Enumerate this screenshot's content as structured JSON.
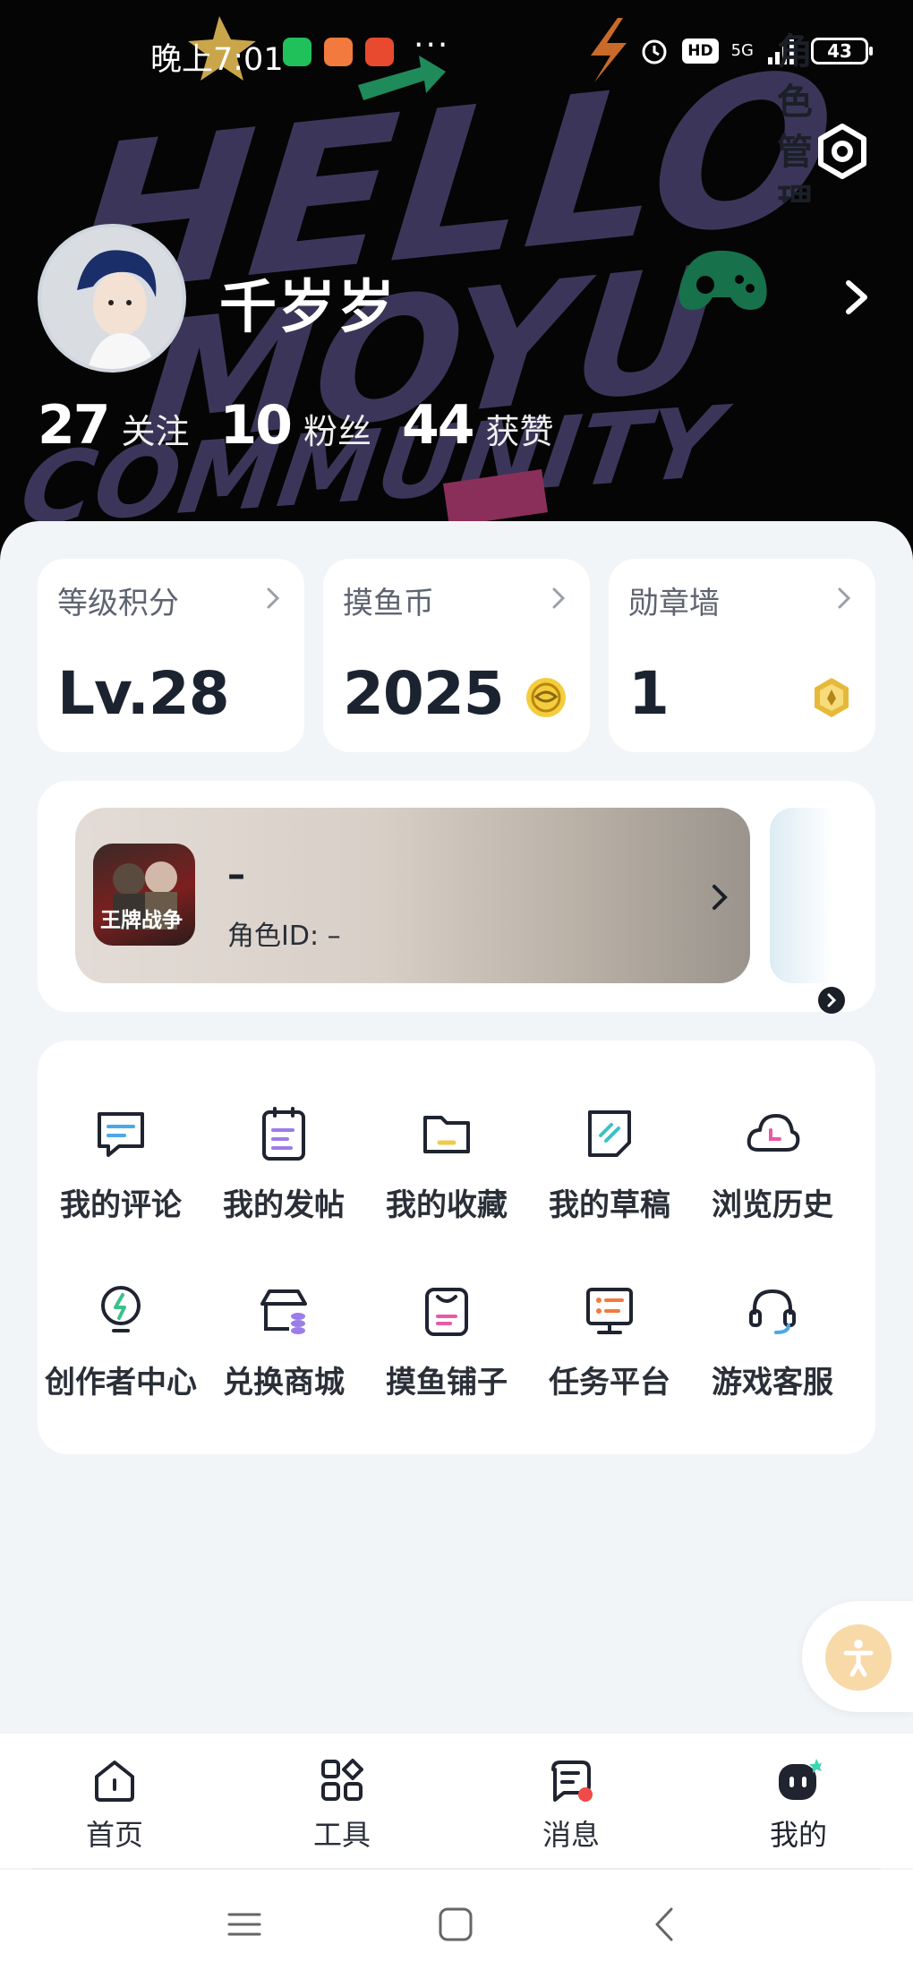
{
  "status_bar": {
    "time": "晚上7:01",
    "more": "···",
    "hd": "HD",
    "network": "5G",
    "battery": "43"
  },
  "profile": {
    "username": "千岁岁",
    "stats": [
      {
        "value": "27",
        "label": "关注"
      },
      {
        "value": "10",
        "label": "粉丝"
      },
      {
        "value": "44",
        "label": "获赞"
      }
    ]
  },
  "cards": [
    {
      "title": "等级积分",
      "value": "Lv.28"
    },
    {
      "title": "摸鱼币",
      "value": "2025",
      "icon": "coin-icon"
    },
    {
      "title": "勋章墙",
      "value": "1",
      "icon": "medal-icon"
    }
  ],
  "role": {
    "game_name": "王牌战争",
    "name": "–",
    "id_text": "角色ID: –",
    "manage_label": "角色管理"
  },
  "menu": [
    {
      "label": "我的评论",
      "icon": "comment-icon"
    },
    {
      "label": "我的发帖",
      "icon": "post-icon"
    },
    {
      "label": "我的收藏",
      "icon": "folder-icon"
    },
    {
      "label": "我的草稿",
      "icon": "draft-icon"
    },
    {
      "label": "浏览历史",
      "icon": "history-icon"
    },
    {
      "label": "创作者中心",
      "icon": "bulb-icon"
    },
    {
      "label": "兑换商城",
      "icon": "shop-icon"
    },
    {
      "label": "摸鱼铺子",
      "icon": "bag-icon"
    },
    {
      "label": "任务平台",
      "icon": "task-icon"
    },
    {
      "label": "游戏客服",
      "icon": "headset-icon"
    }
  ],
  "tabs": [
    {
      "label": "首页",
      "icon": "home-icon"
    },
    {
      "label": "工具",
      "icon": "tools-icon"
    },
    {
      "label": "消息",
      "icon": "message-icon"
    },
    {
      "label": "我的",
      "icon": "profile-icon",
      "active": true
    }
  ],
  "colors": {
    "header_bg": "#050505",
    "page_bg": "#f2f5f8",
    "accent_yellow": "#f2c94c",
    "notification_dot": "#f04a4a",
    "float_button": "#f8d9a8"
  }
}
